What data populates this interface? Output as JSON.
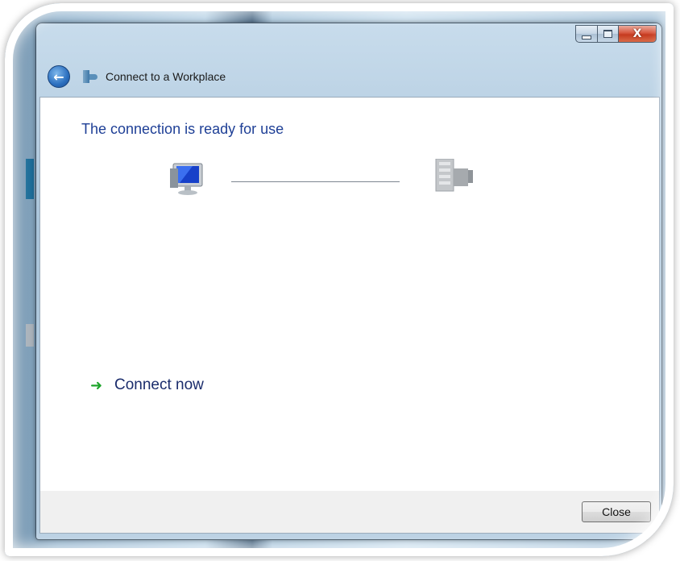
{
  "window": {
    "title": "Connect to a Workplace",
    "controls": {
      "minimize_icon": "minimize-icon",
      "maximize_icon": "maximize-icon",
      "close_glyph": "X"
    }
  },
  "main": {
    "heading": "The connection is ready for use",
    "action_label": "Connect now"
  },
  "footer": {
    "close_label": "Close"
  },
  "colors": {
    "heading": "#1e3f96",
    "link_text": "#1a2c6c",
    "arrow": "#1fa52c"
  }
}
